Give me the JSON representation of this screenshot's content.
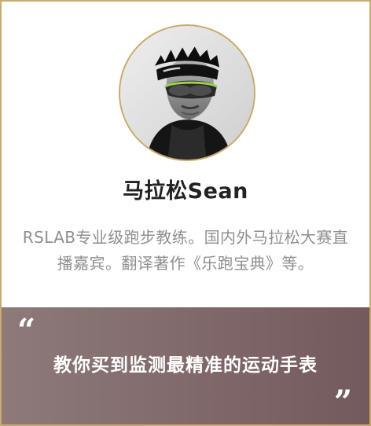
{
  "profile": {
    "name": "马拉松Sean",
    "bio": "RSLAB专业级跑步教练。国内外马拉松大赛直播嘉宾。翻译著作《乐跑宝典》等。"
  },
  "banner": {
    "quote_open": "“",
    "tagline": "教你买到监测最精准的运动手表",
    "quote_close": "”"
  },
  "colors": {
    "border": "#c8ab6b",
    "name_text": "#222222",
    "bio_text": "#8f8f8f",
    "banner_start": "#8d7a79",
    "banner_end": "#745a5d"
  },
  "icons": {
    "open_quote": "open-quote-icon",
    "close_quote": "close-quote-icon"
  }
}
